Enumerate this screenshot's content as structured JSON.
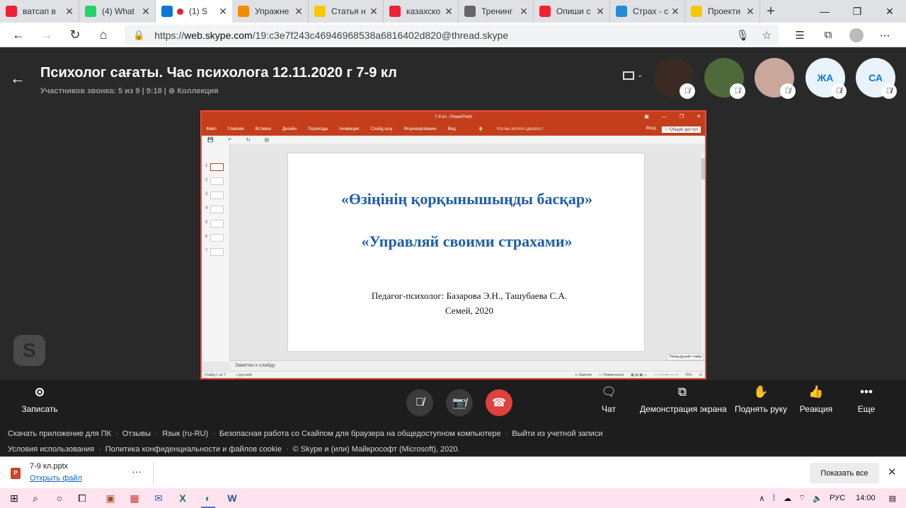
{
  "browser": {
    "tabs": [
      {
        "title": "ватсап в",
        "icon": "yandex-icon",
        "color": "#e23"
      },
      {
        "title": "(4) What",
        "icon": "whatsapp-icon",
        "color": "#25d366"
      },
      {
        "title": "(1) S",
        "icon": "skype-icon",
        "color": "#0a78d4"
      },
      {
        "title": "Упражне",
        "icon": "psychology-icon",
        "color": "#f28c00"
      },
      {
        "title": "Статья н",
        "icon": "bookmark-icon",
        "color": "#f6c800"
      },
      {
        "title": "казахско",
        "icon": "yandex-icon",
        "color": "#e23"
      },
      {
        "title": "Тренинг",
        "icon": "chart-icon",
        "color": "#666"
      },
      {
        "title": "Опиши с",
        "icon": "yandex-icon",
        "color": "#e23"
      },
      {
        "title": "Страх - с",
        "icon": "wiki-icon",
        "color": "#2a8ad4"
      },
      {
        "title": "Проекти",
        "icon": "bookmark-icon",
        "color": "#f6c800"
      }
    ],
    "url_prefix": "https://",
    "url_domain": "web.skype.com",
    "url_path": "/19:c3e7f243c46946968538a6816402d820@thread.skype"
  },
  "call": {
    "title": "Психолог сағаты. Час психолога 12.11.2020 г 7-9 кл",
    "subtitle": "Участников звонка: 5 из 9 | 9:18 |",
    "collection": "Коллекция",
    "participants": [
      {
        "initials": "",
        "color": "#3a2a22"
      },
      {
        "initials": "",
        "color": "#4e6a3a"
      },
      {
        "initials": "",
        "color": "#c9a79a"
      },
      {
        "initials": "ЖА",
        "color": "#e9f3fb"
      },
      {
        "initials": "СА",
        "color": "#e9f3fb"
      }
    ]
  },
  "ppt": {
    "window_title": "7-9 кл - PowerPoint",
    "ribbon": [
      "Файл",
      "Главная",
      "Вставка",
      "Дизайн",
      "Переходы",
      "Анимация",
      "Слайд-шоу",
      "Рецензирование",
      "Вид"
    ],
    "tell_me": "Что вы хотите сделать?",
    "signin": "Вход",
    "share": "Общий доступ",
    "thumbs": [
      "1",
      "2",
      "3",
      "4",
      "5",
      "6",
      "7"
    ],
    "slide_kz": "«Өзіңінің қорқынышыңды басқар»",
    "slide_ru": "«Управляй своими страхами»",
    "slide_author": "Педагог-психолог: Базарова Э.Н., Ташубаева С.А.",
    "slide_city": "Семей, 2020",
    "prev_slide": "Предыдущий слайд",
    "notes": "Заметки к слайду",
    "status_left": "Слайд 1 из 7",
    "status_lang": "русский",
    "status_notes": "Заметки",
    "status_comments": "Примечания",
    "status_zoom": "76%"
  },
  "controls": {
    "record": "Записать",
    "chat": "Чат",
    "share_screen": "Демонстрация экрана",
    "raise_hand": "Поднять руку",
    "reaction": "Реакция",
    "more": "Еще"
  },
  "footer": {
    "row1": [
      "Скачать приложение для ПК",
      "Отзывы",
      "Язык (ru-RU)",
      "Безопасная работа со Скайпом для браузера на общедоступном компьютере",
      "Выйти из учетной записи"
    ],
    "row2": [
      "Условия использования",
      "Политика конфиденциальности и файлов cookie",
      "© Skype и (или) Майкрософт (Microsoft), 2020."
    ]
  },
  "download": {
    "file": "7-9 кл.pptx",
    "open": "Открыть файл",
    "show_all": "Показать все"
  },
  "taskbar": {
    "lang": "РУС",
    "time": "14:00"
  }
}
